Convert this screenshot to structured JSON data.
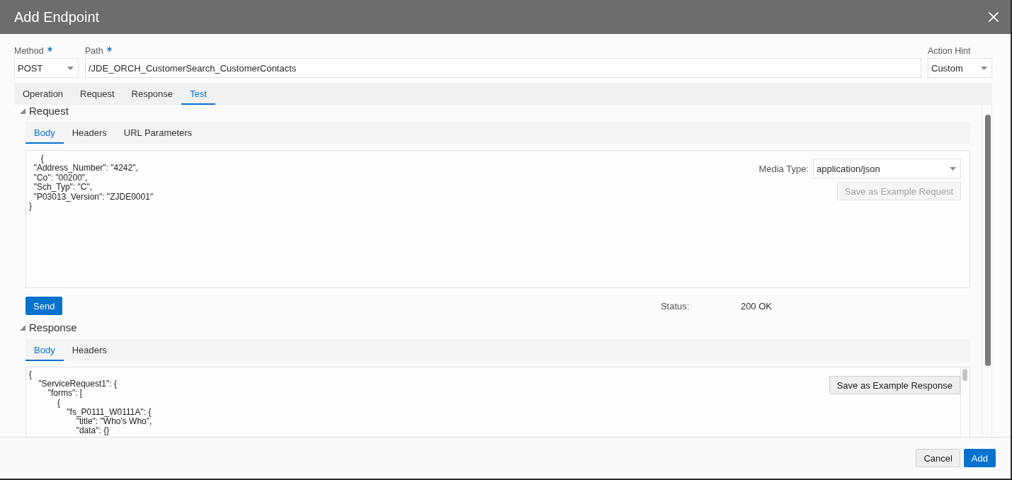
{
  "dialog": {
    "title": "Add Endpoint"
  },
  "fields": [
    {
      "kind": "select",
      "label": "Method",
      "required": true,
      "value": "POST"
    },
    {
      "kind": "text",
      "label": "Path",
      "required": true,
      "value": "/JDE_ORCH_CustomerSearch_CustomerContacts"
    },
    {
      "kind": "select",
      "label": "Action Hint",
      "required": false,
      "value": "Custom"
    }
  ],
  "tabs": [
    {
      "label": "Operation",
      "selected": false
    },
    {
      "label": "Request",
      "selected": false
    },
    {
      "label": "Response",
      "selected": false
    },
    {
      "label": "Test",
      "selected": true
    }
  ],
  "request": {
    "title": "Request",
    "expanded": true,
    "tabs": [
      {
        "label": "Body",
        "selected": true
      },
      {
        "label": "Headers",
        "selected": false
      },
      {
        "label": "URL Parameters",
        "selected": false
      }
    ],
    "body_lines": [
      "     {",
      "  \"Address_Number\": \"4242\",",
      "  \"Co\": \"00200\",",
      "  \"Sch_Typ\": \"C\",",
      "  \"P03013_Version\": \"ZJDE0001\"",
      "}"
    ],
    "media_type": {
      "label": "Media Type:",
      "value": "application/json"
    },
    "save_button": {
      "label": "Save as Example Request",
      "disabled": true
    },
    "send_button": {
      "label": "Send"
    },
    "status": {
      "label": "Status:",
      "value": "200 OK"
    }
  },
  "response": {
    "title": "Response",
    "expanded": true,
    "tabs": [
      {
        "label": "Body",
        "selected": true
      },
      {
        "label": "Headers",
        "selected": false
      }
    ],
    "body_lines": [
      "{",
      "    \"ServiceRequest1\": {",
      "        \"forms\": [",
      "            {",
      "                \"fs_P0111_W0111A\": {",
      "                    \"title\": \"Who's Who\",",
      "                    \"data\": {}"
    ],
    "save_button": {
      "label": "Save as Example Response",
      "disabled": false
    }
  },
  "footer": {
    "buttons": [
      {
        "label": "Cancel",
        "kind": "secondary"
      },
      {
        "label": "Add",
        "kind": "primary"
      }
    ]
  }
}
